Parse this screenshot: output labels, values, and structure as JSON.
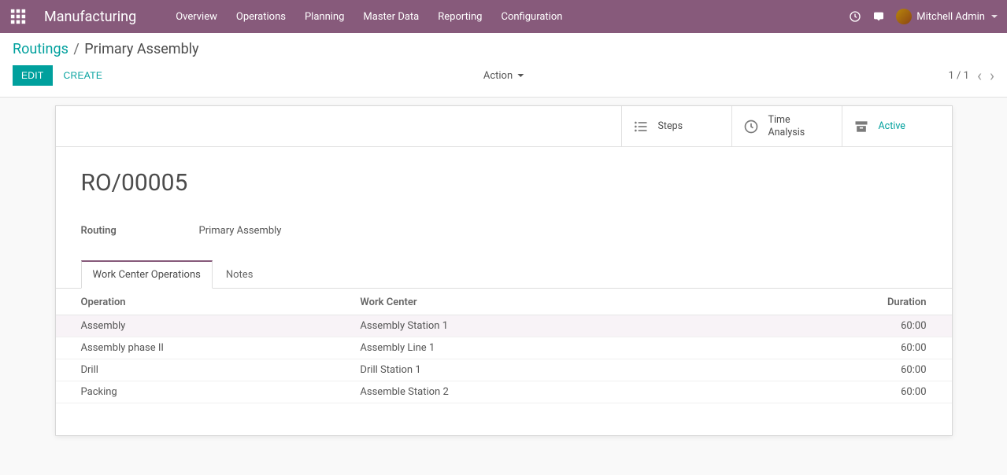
{
  "topbar": {
    "module": "Manufacturing",
    "menu": [
      "Overview",
      "Operations",
      "Planning",
      "Master Data",
      "Reporting",
      "Configuration"
    ],
    "user": "Mitchell Admin"
  },
  "breadcrumb": {
    "parent": "Routings",
    "current": "Primary Assembly"
  },
  "controls": {
    "edit": "EDIT",
    "create": "CREATE",
    "action": "Action",
    "pager": "1 / 1"
  },
  "stat_buttons": {
    "steps": "Steps",
    "time_line1": "Time",
    "time_line2": "Analysis",
    "active": "Active"
  },
  "record": {
    "name": "RO/00005",
    "routing_label": "Routing",
    "routing_value": "Primary Assembly"
  },
  "tabs": {
    "ops": "Work Center Operations",
    "notes": "Notes"
  },
  "table": {
    "headers": {
      "operation": "Operation",
      "workcenter": "Work Center",
      "duration": "Duration"
    },
    "rows": [
      {
        "operation": "Assembly",
        "workcenter": "Assembly Station 1",
        "duration": "60:00"
      },
      {
        "operation": "Assembly phase II",
        "workcenter": "Assembly Line 1",
        "duration": "60:00"
      },
      {
        "operation": "Drill",
        "workcenter": "Drill Station 1",
        "duration": "60:00"
      },
      {
        "operation": "Packing",
        "workcenter": "Assemble Station 2",
        "duration": "60:00"
      }
    ]
  }
}
